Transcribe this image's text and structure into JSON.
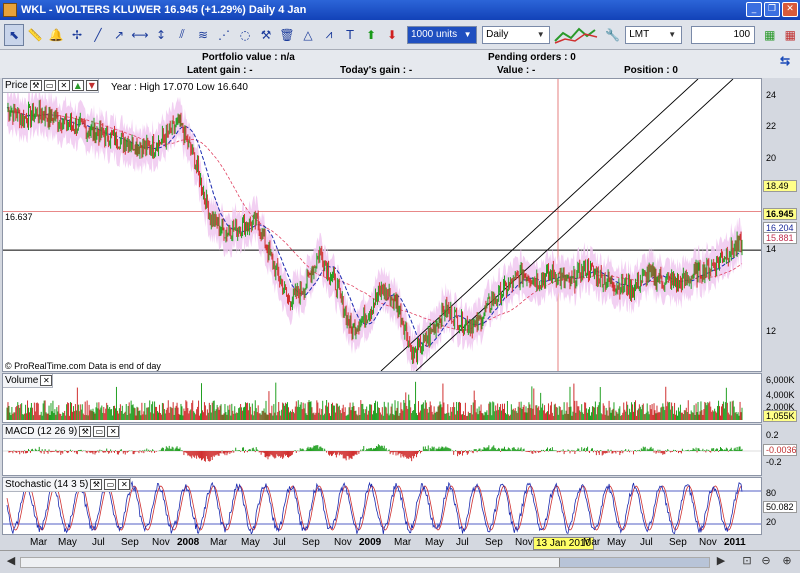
{
  "window": {
    "title": "WKL - WOLTERS KLUWER     16.945 (+1.29%)    Daily  4 Jan",
    "minimize_glyph": "_",
    "restore_glyph": "❐",
    "close_glyph": "✕"
  },
  "toolbar": {
    "size_select": "1000 units",
    "period_select": "Daily",
    "order_type_select": "LMT",
    "quantity_value": "100",
    "tools": [
      {
        "icon": "pointer-icon",
        "glyph": "⬉"
      },
      {
        "icon": "ruler-icon",
        "glyph": "📏"
      },
      {
        "icon": "alarm-bell-icon",
        "glyph": "🔔"
      },
      {
        "icon": "crosshair-icon",
        "glyph": "✢"
      },
      {
        "icon": "line-icon",
        "glyph": "╱"
      },
      {
        "icon": "ray-icon",
        "glyph": "↗"
      },
      {
        "icon": "horizontal-line-icon",
        "glyph": "⟷"
      },
      {
        "icon": "vertical-line-icon",
        "glyph": "↕"
      },
      {
        "icon": "channel-icon",
        "glyph": "⫽"
      },
      {
        "icon": "fibonacci-icon",
        "glyph": "≋"
      },
      {
        "icon": "fan-icon",
        "glyph": "⋰"
      },
      {
        "icon": "ellipse-icon",
        "glyph": "◌"
      },
      {
        "icon": "hammer-icon",
        "glyph": "⚒"
      },
      {
        "icon": "delete-icon",
        "glyph": "🗑"
      },
      {
        "icon": "triangle-icon",
        "glyph": "△"
      },
      {
        "icon": "pattern-icon",
        "glyph": "⩘"
      },
      {
        "icon": "text-icon",
        "glyph": "T"
      },
      {
        "icon": "buy-arrow-icon",
        "glyph": "⬆"
      },
      {
        "icon": "sell-arrow-icon",
        "glyph": "⬇"
      }
    ]
  },
  "info": {
    "portfolio_label": "Portfolio value : n/a",
    "latent_label": "Latent gain : -",
    "today_label": "Today's gain : -",
    "pending_label": "Pending orders : 0",
    "value_label": "Value : -",
    "position_label": "Position : 0"
  },
  "price_panel": {
    "label": "Price",
    "year_info": "Year : High 17.070 Low 16.640",
    "level_label": "16.637",
    "source_note": "© ProRealTime.com  Data is end of day",
    "axis_ticks": [
      "24",
      "22",
      "20",
      "18",
      "16",
      "14",
      "12"
    ],
    "tag_red": "18.49",
    "tag_last": "16.945",
    "tag_blue": "16.204",
    "tag_pink": "15.881"
  },
  "volume_panel": {
    "label": "Volume",
    "axis_ticks": [
      "6,000K",
      "4,000K",
      "2,000K"
    ],
    "tag": "1,055K"
  },
  "macd_panel": {
    "label": "MACD (12 26 9)",
    "axis_ticks": [
      "0.2",
      "0",
      "-0.2"
    ],
    "tag": "-0.0036"
  },
  "stoch_panel": {
    "label": "Stochastic (14 3 5)",
    "axis_ticks": [
      "80",
      "20"
    ],
    "tag": "50.082"
  },
  "x_axis": {
    "labels": [
      "Mar",
      "May",
      "Jul",
      "Sep",
      "Nov",
      "2008",
      "Mar",
      "May",
      "Jul",
      "Sep",
      "Nov",
      "2009",
      "Mar",
      "May",
      "Jul",
      "Sep",
      "Nov",
      "Mar",
      "May",
      "Jul",
      "Sep",
      "Nov",
      "2011"
    ],
    "cursor_date": "13 Jan 2010"
  },
  "chart_data": {
    "type": "line",
    "title": "WKL - WOLTERS KLUWER",
    "x": [
      "2007-02",
      "2007-03",
      "2007-04",
      "2007-05",
      "2007-06",
      "2007-07",
      "2007-08",
      "2007-09",
      "2007-10",
      "2007-11",
      "2007-12",
      "2008-01",
      "2008-02",
      "2008-03",
      "2008-04",
      "2008-05",
      "2008-06",
      "2008-07",
      "2008-08",
      "2008-09",
      "2008-10",
      "2008-11",
      "2008-12",
      "2009-01",
      "2009-02",
      "2009-03",
      "2009-04",
      "2009-05",
      "2009-06",
      "2009-07",
      "2009-08",
      "2009-09",
      "2009-10",
      "2009-11",
      "2009-12",
      "2010-01",
      "2010-02",
      "2010-03",
      "2010-04",
      "2010-05",
      "2010-06",
      "2010-07",
      "2010-08",
      "2010-09",
      "2010-10",
      "2010-11",
      "2010-12",
      "2011-01"
    ],
    "series": [
      {
        "values": [
          23.5,
          23.0,
          23.3,
          23.0,
          22.7,
          22.5,
          22.2,
          22.0,
          21.8,
          21.5,
          22.0,
          22.8,
          21.0,
          18.2,
          17.5,
          17.8,
          18.0,
          16.0,
          14.2,
          14.8,
          16.5,
          15.0,
          12.8,
          13.5,
          14.8,
          14.0,
          11.5,
          12.5,
          13.8,
          13.2,
          13.0,
          14.2,
          14.8,
          15.5,
          15.2,
          15.5,
          15.0,
          15.8,
          15.3,
          15.0,
          14.8,
          15.5,
          15.2,
          15.0,
          15.5,
          15.8,
          16.5,
          16.95
        ]
      }
    ],
    "ylim": [
      11,
      24.5
    ],
    "reference_lines": [
      18.49,
      16.637
    ]
  }
}
